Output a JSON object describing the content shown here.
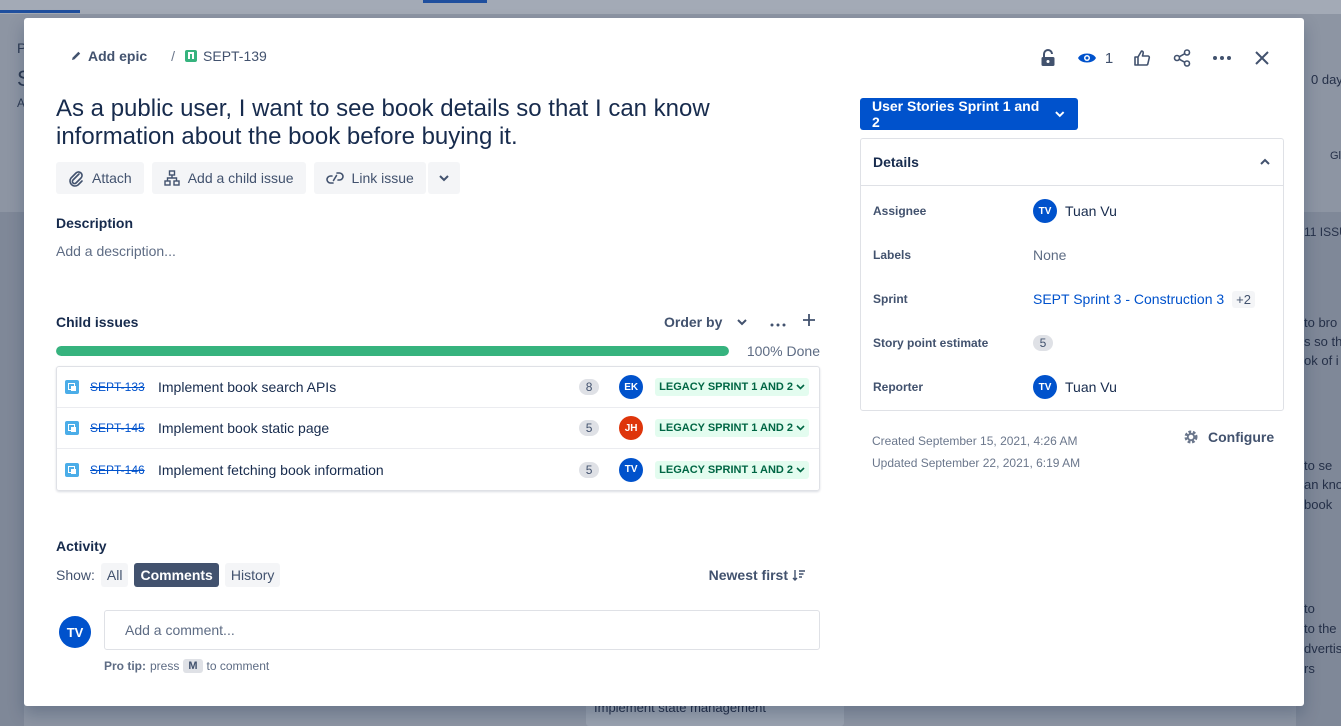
{
  "background": {
    "left_fragments": [
      "P",
      "S",
      "A"
    ],
    "right_fragments": [
      "0 day",
      "Gl",
      "11 ISSU",
      "to bro",
      "s so th",
      "ok of i",
      "to se",
      "an kno",
      "book",
      "to",
      "to the",
      "dvertis",
      "rs"
    ],
    "card_text": "Implement state management"
  },
  "breadcrumb": {
    "add_epic": "Add epic",
    "separator": "/",
    "issue_key": "SEPT-139"
  },
  "top_actions": {
    "watch_count": "1"
  },
  "issue": {
    "title": "As a public user, I want to see book details so that I can know information about the book before buying it."
  },
  "action_buttons": {
    "attach": "Attach",
    "add_child": "Add a child issue",
    "link_issue": "Link issue"
  },
  "description": {
    "label": "Description",
    "placeholder": "Add a description..."
  },
  "child_issues": {
    "label": "Child issues",
    "order_by": "Order by",
    "progress_fraction": 1.0,
    "progress_label": "100% Done",
    "items": [
      {
        "key": "SEPT-133",
        "summary": "Implement book search APIs",
        "points": "8",
        "assignee": "EK",
        "avatar_color": "#0052cc",
        "status": "LEGACY SPRINT 1 AND 2"
      },
      {
        "key": "SEPT-145",
        "summary": "Implement book static page",
        "points": "5",
        "assignee": "JH",
        "avatar_color": "#de350b",
        "status": "LEGACY SPRINT 1 AND 2"
      },
      {
        "key": "SEPT-146",
        "summary": "Implement fetching book information",
        "points": "5",
        "assignee": "TV",
        "avatar_color": "#0052cc",
        "status": "LEGACY SPRINT 1 AND 2"
      }
    ]
  },
  "activity": {
    "label": "Activity",
    "show_label": "Show:",
    "filters": [
      "All",
      "Comments",
      "History"
    ],
    "active_filter": "Comments",
    "sort": "Newest first",
    "current_user_initials": "TV",
    "comment_placeholder": "Add a comment...",
    "protip_bold": "Pro tip:",
    "protip_press": "press",
    "protip_key": "M",
    "protip_rest": "to comment"
  },
  "status_button": "User Stories Sprint 1 and 2",
  "details": {
    "header": "Details",
    "assignee_label": "Assignee",
    "assignee_initials": "TV",
    "assignee_name": "Tuan Vu",
    "labels_label": "Labels",
    "labels_value": "None",
    "sprint_label": "Sprint",
    "sprint_value": "SEPT Sprint 3 - Construction 3",
    "sprint_more": "+2",
    "story_points_label": "Story point estimate",
    "story_points_value": "5",
    "reporter_label": "Reporter",
    "reporter_initials": "TV",
    "reporter_name": "Tuan Vu"
  },
  "meta": {
    "created": "Created September 15, 2021, 4:26 AM",
    "updated": "Updated September 22, 2021, 6:19 AM",
    "configure": "Configure"
  },
  "colors": {
    "brand_blue": "#0052cc",
    "progress_green": "#36b37e",
    "status_green_bg": "#e3fcef",
    "status_green_text": "#006644"
  }
}
